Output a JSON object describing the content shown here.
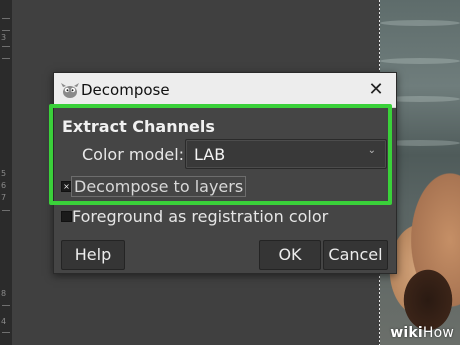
{
  "dialog": {
    "title": "Decompose",
    "close_glyph": "✕",
    "section_title": "Extract Channels",
    "color_model": {
      "label": "Color model:",
      "value": "LAB"
    },
    "checkboxes": [
      {
        "label": "Decompose to layers",
        "checked": true
      },
      {
        "label": "Foreground as registration color",
        "checked": false
      }
    ],
    "buttons": {
      "help": "Help",
      "ok": "OK",
      "cancel": "Cancel"
    }
  },
  "ruler": {
    "numbers": [
      "3",
      "5",
      "6",
      "7",
      "8",
      "4"
    ]
  },
  "watermark": {
    "brand": "wiki",
    "suffix": "How"
  },
  "colors": {
    "highlight": "#3ad13a",
    "dialog_bg": "#454545",
    "titlebar_bg": "#ededed",
    "canvas_bg": "#404040"
  }
}
